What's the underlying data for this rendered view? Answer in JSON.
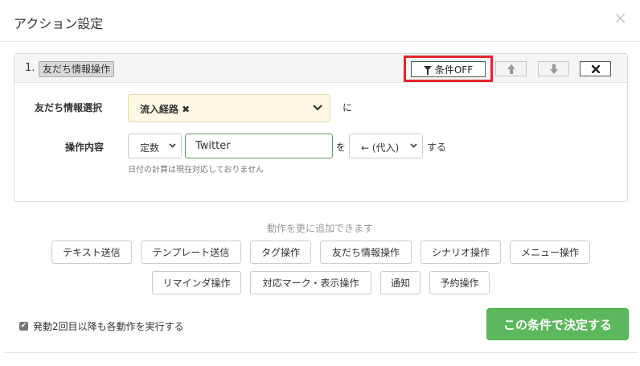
{
  "modal": {
    "title": "アクション設定",
    "close": "×"
  },
  "action": {
    "number": "1.",
    "badge": "友だち情報操作",
    "condition_button": "条件OFF",
    "up_icon": "arrow-up-icon",
    "down_icon": "arrow-down-icon",
    "delete_icon": "close-icon",
    "field1_label": "友だち情報選択",
    "field1_value": "流入経路 ✖",
    "field1_suffix": "に",
    "field2_label": "操作内容",
    "type_select": "定数",
    "input_value": "Twitter",
    "connector": "を",
    "op_select": "← (代入)",
    "op_suffix": "する",
    "hint": "日付の計算は現在対応しておりません"
  },
  "add_section": {
    "label": "動作を更に追加できます",
    "buttons_row1": [
      "テキスト送信",
      "テンプレート送信",
      "タグ操作",
      "友だち情報操作",
      "シナリオ操作",
      "メニュー操作"
    ],
    "buttons_row2": [
      "リマインダ操作",
      "対応マーク・表示操作",
      "通知",
      "予約操作"
    ]
  },
  "footer": {
    "repeat_label": "発動2回目以降も各動作を実行する",
    "repeat_checked": true,
    "submit": "この条件で決定する"
  },
  "colors": {
    "submit": "#5cb85c",
    "highlight": "#e1262b",
    "select_bg": "#fcf8e3",
    "input_border": "#5aa65a"
  }
}
